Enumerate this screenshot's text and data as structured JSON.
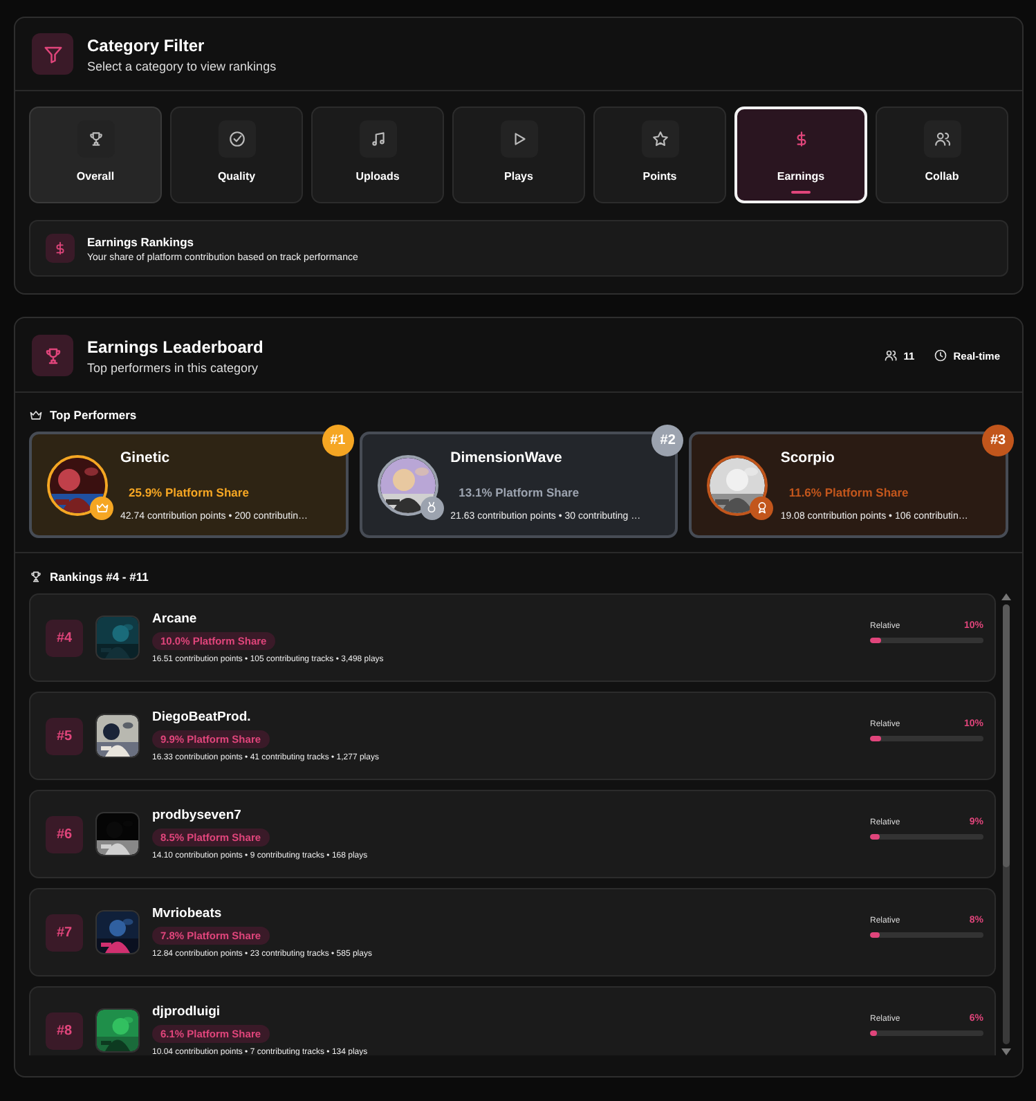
{
  "category_filter": {
    "title": "Category Filter",
    "subtitle": "Select a category to view rankings",
    "categories": [
      {
        "label": "Overall",
        "selected": false,
        "hovered": true
      },
      {
        "label": "Quality",
        "selected": false,
        "hovered": false
      },
      {
        "label": "Uploads",
        "selected": false,
        "hovered": false
      },
      {
        "label": "Plays",
        "selected": false,
        "hovered": false
      },
      {
        "label": "Points",
        "selected": false,
        "hovered": false
      },
      {
        "label": "Earnings",
        "selected": true,
        "hovered": false
      },
      {
        "label": "Collab",
        "selected": false,
        "hovered": false
      }
    ],
    "info": {
      "title": "Earnings Rankings",
      "text": "Your share of platform contribution based on track performance"
    }
  },
  "leaderboard": {
    "title": "Earnings Leaderboard",
    "subtitle": "Top performers in this category",
    "participants": "11",
    "mode": "Real-time",
    "top_heading": "Top Performers",
    "top": [
      {
        "rank": "#1",
        "name": "Ginetic",
        "share": "25.9% Platform Share",
        "stats": "42.74 contribution points • 200 contributin…",
        "color": "#f5a623"
      },
      {
        "rank": "#2",
        "name": "DimensionWave",
        "share": "13.1% Platform Share",
        "stats": "21.63 contribution points • 30 contributing …",
        "color": "#9ca3af"
      },
      {
        "rank": "#3",
        "name": "Scorpio",
        "share": "11.6% Platform Share",
        "stats": "19.08 contribution points • 106 contributin…",
        "color": "#c2561c"
      }
    ],
    "rankings_heading": "Rankings #4 - #11",
    "rows": [
      {
        "rank": "#4",
        "name": "Arcane",
        "share": "10.0% Platform Share",
        "stats": "16.51 contribution points • 105 contributing tracks • 3,498 plays",
        "relative_label": "Relative",
        "relative": "10%",
        "level": 0.1
      },
      {
        "rank": "#5",
        "name": "DiegoBeatProd.",
        "share": "9.9% Platform Share",
        "stats": "16.33 contribution points • 41 contributing tracks • 1,277 plays",
        "relative_label": "Relative",
        "relative": "10%",
        "level": 0.1
      },
      {
        "rank": "#6",
        "name": "prodbyseven7",
        "share": "8.5% Platform Share",
        "stats": "14.10 contribution points • 9 contributing tracks • 168 plays",
        "relative_label": "Relative",
        "relative": "9%",
        "level": 0.09
      },
      {
        "rank": "#7",
        "name": "Mvriobeats",
        "share": "7.8% Platform Share",
        "stats": "12.84 contribution points • 23 contributing tracks • 585 plays",
        "relative_label": "Relative",
        "relative": "8%",
        "level": 0.08
      },
      {
        "rank": "#8",
        "name": "djprodluigi",
        "share": "6.1% Platform Share",
        "stats": "10.04 contribution points • 7 contributing tracks • 134 plays",
        "relative_label": "Relative",
        "relative": "6%",
        "level": 0.06
      }
    ]
  }
}
